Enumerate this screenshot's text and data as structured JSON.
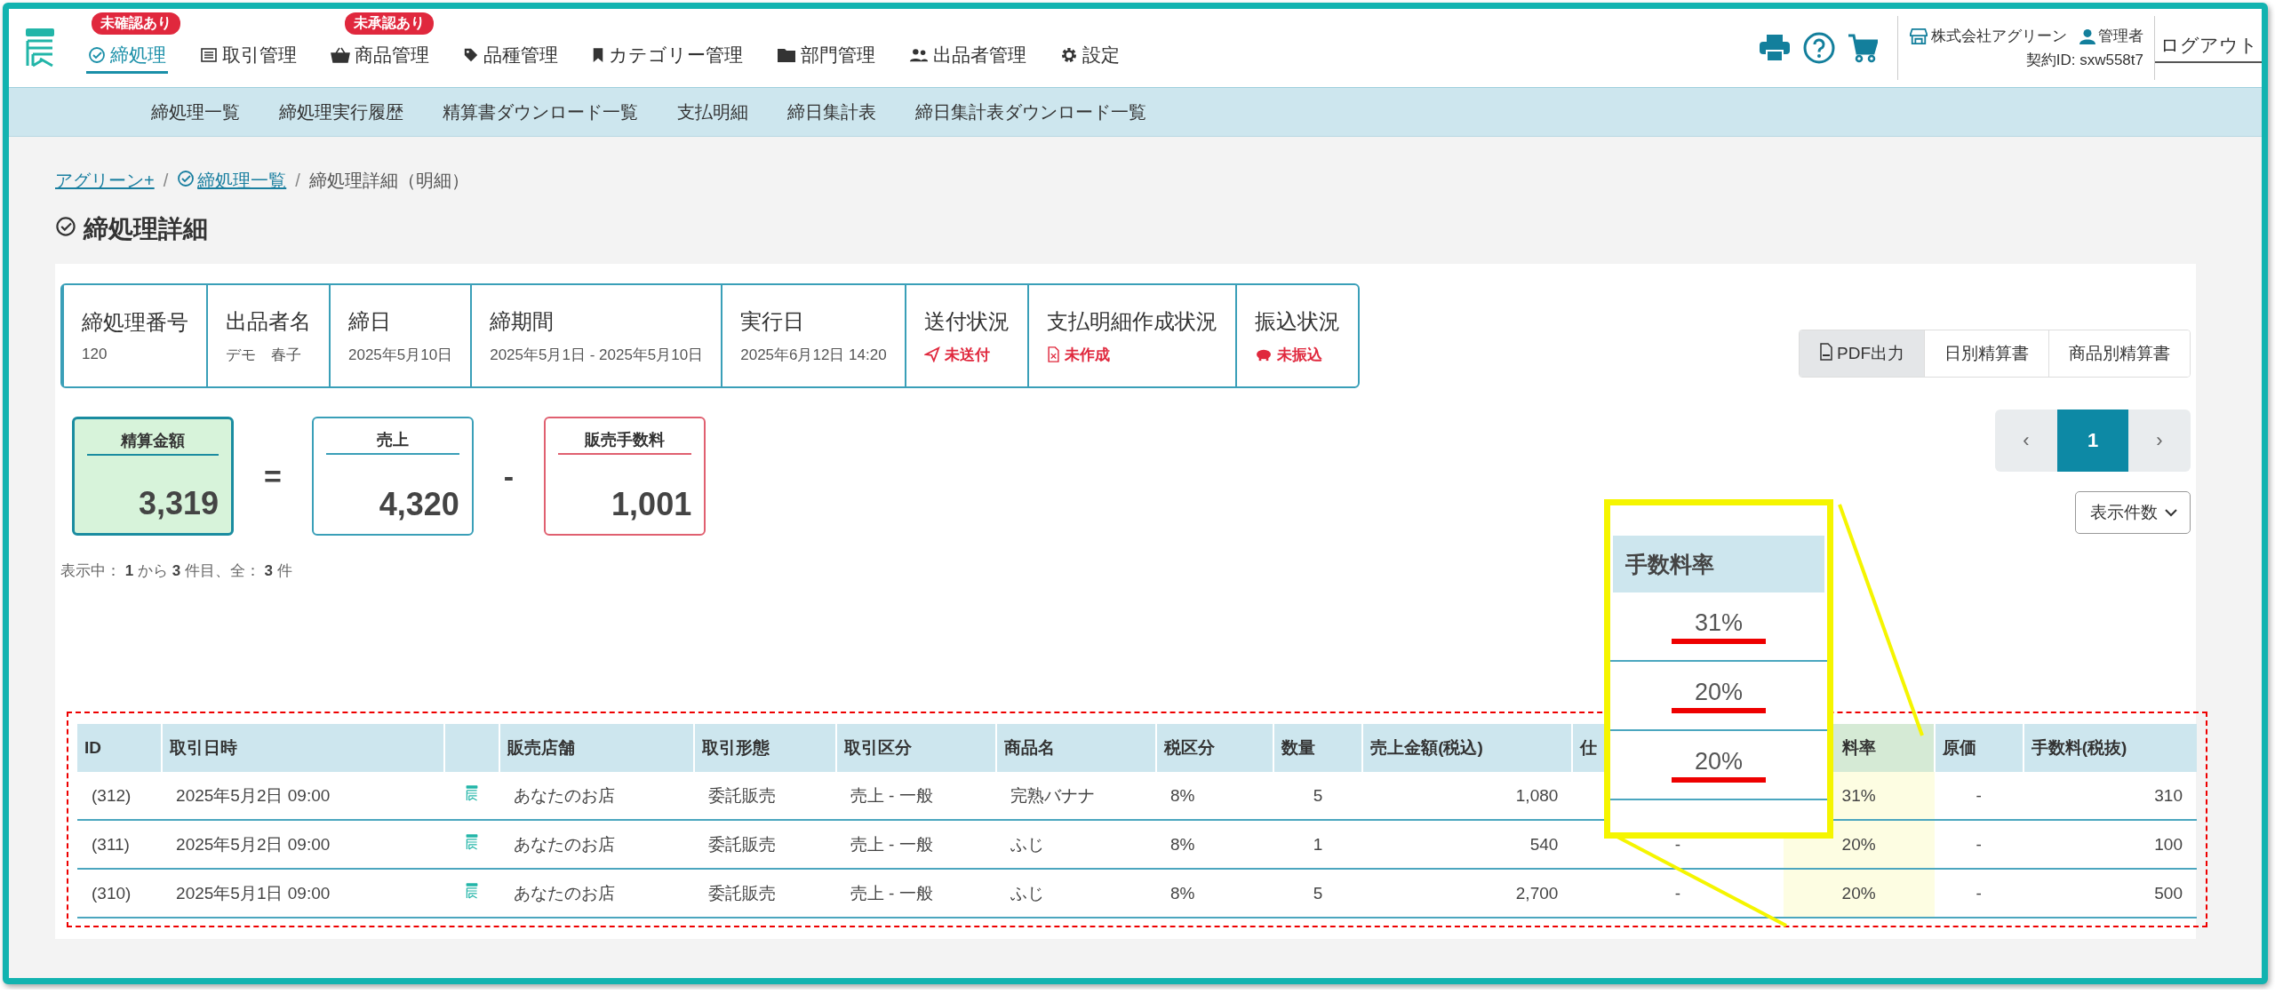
{
  "header": {
    "nav": [
      {
        "label": "締処理",
        "selected": true,
        "badge": "未確認あり"
      },
      {
        "label": "取引管理",
        "selected": false
      },
      {
        "label": "商品管理",
        "selected": false,
        "badge": "未承認あり"
      },
      {
        "label": "品種管理",
        "selected": false
      },
      {
        "label": "カテゴリー管理",
        "selected": false
      },
      {
        "label": "部門管理",
        "selected": false
      },
      {
        "label": "出品者管理",
        "selected": false
      },
      {
        "label": "設定",
        "selected": false
      }
    ],
    "company": "株式会社アグリーン",
    "user": "管理者",
    "contract": "契約ID: sxw558t7",
    "logout": "ログアウト"
  },
  "subnav": [
    "締処理一覧",
    "締処理実行履歴",
    "精算書ダウンロード一覧",
    "支払明細",
    "締日集計表",
    "締日集計表ダウンロード一覧"
  ],
  "breadcrumb": [
    {
      "label": "アグリーン+",
      "kind": "link"
    },
    {
      "label": "/",
      "kind": "separator"
    },
    {
      "label": "締処理一覧",
      "kind": "link"
    },
    {
      "label": "/",
      "kind": "separator"
    },
    {
      "label": "締処理詳細（明細）",
      "kind": "current"
    }
  ],
  "title": "締処理詳細",
  "info": [
    {
      "label": "締処理番号",
      "value": "120",
      "kind": "text"
    },
    {
      "label": "出品者名",
      "value": "デモ　春子",
      "kind": "text"
    },
    {
      "label": "締日",
      "value": "2025年5月10日",
      "kind": "text"
    },
    {
      "label": "締期間",
      "value": "2025年5月1日 - 2025年5月10日",
      "kind": "text"
    },
    {
      "label": "実行日",
      "value": "2025年6月12日 14:20",
      "kind": "text"
    },
    {
      "label": "送付状況",
      "value": "未送付",
      "kind": "status"
    },
    {
      "label": "支払明細作成状況",
      "value": "未作成",
      "kind": "status"
    },
    {
      "label": "振込状況",
      "value": "未振込",
      "kind": "status"
    }
  ],
  "actions": [
    {
      "label": "PDF出力",
      "selected": true
    },
    {
      "label": "日別精算書",
      "selected": false
    },
    {
      "label": "商品別精算書",
      "selected": false
    }
  ],
  "summary": [
    {
      "label": "精算金額",
      "value": "3,319",
      "kind": "total"
    },
    {
      "operator": "=",
      "kind": "operator"
    },
    {
      "label": "売上",
      "value": "4,320",
      "kind": "sales"
    },
    {
      "operator": "-",
      "kind": "operator"
    },
    {
      "label": "販売手数料",
      "value": "1,001",
      "kind": "fee"
    }
  ],
  "count_text": "表示中： **1** から **3** 件目、全： **3** 件",
  "pagination": {
    "prev": "‹",
    "pages": [
      {
        "label": "1",
        "selected": true
      }
    ],
    "next": "›"
  },
  "per_page": "表示件数",
  "table": {
    "columns": [
      {
        "label": "ID"
      },
      {
        "label": "取引日時"
      },
      {
        "kind": "icon"
      },
      {
        "label": "販売店舗"
      },
      {
        "label": "取引形態"
      },
      {
        "label": "取引区分"
      },
      {
        "label": "商品名"
      },
      {
        "label": "税区分"
      },
      {
        "label": "数量"
      },
      {
        "label": "売上金額(税込)"
      },
      {
        "label": "仕"
      },
      {
        "label": "料率",
        "highlighted": true
      },
      {
        "label": "原価"
      },
      {
        "label": "手数料(税抜)"
      }
    ],
    "rows": [
      {
        "cells": [
          "(312)",
          "2025年5月2日 09:00",
          "",
          "あなたのお店",
          "委託販売",
          "売上 - 一般",
          "完熟バナナ",
          "8%",
          "5",
          "1,080",
          "",
          "31%",
          "-",
          "310"
        ]
      },
      {
        "cells": [
          "(311)",
          "2025年5月2日 09:00",
          "",
          "あなたのお店",
          "委託販売",
          "売上 - 一般",
          "ふじ",
          "8%",
          "1",
          "540",
          "-",
          "20%",
          "-",
          "100"
        ]
      },
      {
        "cells": [
          "(310)",
          "2025年5月1日 09:00",
          "",
          "あなたのお店",
          "委託販売",
          "売上 - 一般",
          "ふじ",
          "8%",
          "5",
          "2,700",
          "-",
          "20%",
          "-",
          "500"
        ]
      }
    ]
  },
  "callout": {
    "header": "手数料率",
    "values": [
      "31%",
      "20%",
      "20%"
    ]
  }
}
